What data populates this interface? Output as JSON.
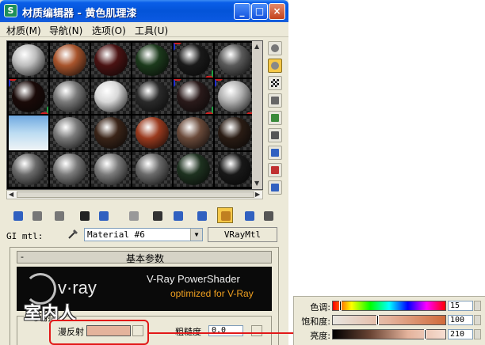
{
  "window": {
    "title": "材质编辑器 - 黄色肌理漆",
    "app_icon": "3ds-max-icon",
    "controls": {
      "minimize": "_",
      "maximize": "□",
      "close": "×"
    }
  },
  "menu": [
    {
      "label": "材质(M)"
    },
    {
      "label": "导航(N)"
    },
    {
      "label": "选项(O)"
    },
    {
      "label": "工具(U)"
    }
  ],
  "slots": [
    {
      "color": "#bdbdbd",
      "active": false
    },
    {
      "color": "#a8542c",
      "active": false
    },
    {
      "color": "#4a1212",
      "active": false
    },
    {
      "color": "#1c3a1c",
      "active": false
    },
    {
      "color": "#1a1a1a",
      "active": false,
      "corners": true
    },
    {
      "color": "#5a5a5a",
      "active": false
    },
    {
      "color": "#1a0a08",
      "active": false,
      "corners": true
    },
    {
      "color": "#7a7a7a",
      "active": false
    },
    {
      "color": "#d8d8d8",
      "active": false
    },
    {
      "color": "#2a2a2a",
      "active": false
    },
    {
      "color": "#2a1a1a",
      "active": false,
      "corners": true
    },
    {
      "color": "#b0b0b0",
      "active": false,
      "corners": true
    },
    {
      "color": "#9cc8ea",
      "active": false,
      "flat": true
    },
    {
      "color": "#7a7a7a",
      "active": false
    },
    {
      "color": "#3a2418",
      "active": false
    },
    {
      "color": "#9a3a1e",
      "active": false
    },
    {
      "color": "#6a4a3a",
      "active": false
    },
    {
      "color": "#2a1c14",
      "active": false
    },
    {
      "color": "#6a6a6a",
      "active": false
    },
    {
      "color": "#7a7a7a",
      "active": false
    },
    {
      "color": "#7a7a7a",
      "active": false
    },
    {
      "color": "#6a6a6a",
      "active": false
    },
    {
      "color": "#1e3220",
      "active": false
    },
    {
      "color": "#181818",
      "active": false
    }
  ],
  "side_tools": [
    "sample-type-sphere-icon",
    "backlight-icon",
    "background-checker-icon",
    "uv-tiling-icon",
    "video-color-check-icon",
    "make-preview-icon",
    "options-icon",
    "select-by-material-icon",
    "material-navigator-icon"
  ],
  "bottom_tools": [
    "get-material-icon",
    "put-to-scene-icon",
    "assign-to-selection-icon",
    "reset-map-icon",
    "make-copy-icon",
    "make-unique-icon",
    "put-to-library-icon",
    "material-id-icon",
    "show-map-icon",
    "show-end-result-icon",
    "go-to-parent-icon",
    "go-forward-sibling-icon"
  ],
  "material_row": {
    "gi_label": "GI mtl:",
    "name": "Material #6",
    "type": "VRayMtl"
  },
  "rollout": {
    "toggle": "-",
    "title": "基本参数"
  },
  "banner": {
    "logo": "v·ray",
    "line1": "V-Ray PowerShader",
    "line2": "optimized for V-Ray",
    "colors": {
      "background": "#0a0a0a",
      "accent": "#f0a020"
    }
  },
  "diffuse_group": {
    "label": "反射",
    "diffuse_label": "漫反射",
    "diffuse_color": "#e4b39c",
    "roughness_label": "粗糙度",
    "roughness_value": "0.0"
  },
  "watermark": "室内人",
  "color_picker": {
    "rows": [
      {
        "label": "色调:",
        "value": "15",
        "marker": 0.06
      },
      {
        "label": "饱和度:",
        "value": "100",
        "marker": 0.39
      },
      {
        "label": "亮度:",
        "value": "210",
        "marker": 0.82
      }
    ]
  },
  "highlight_color": "#e21818"
}
